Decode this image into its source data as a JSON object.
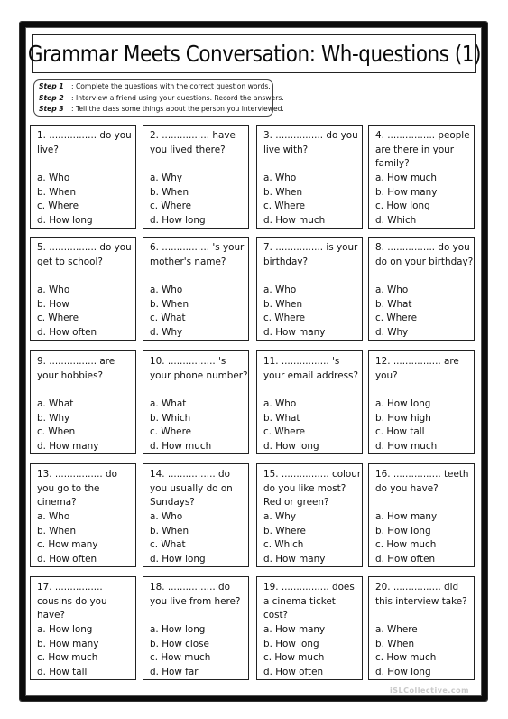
{
  "title": "Grammar Meets Conversation: Wh-questions (1)",
  "steps": [
    {
      "label": "Step 1",
      "text": ": Complete the questions with the correct question words."
    },
    {
      "label": "Step 2",
      "text": ": Interview a friend using your questions. Record the answers."
    },
    {
      "label": "Step 3",
      "text": ": Tell the class some things about the person you interviewed."
    }
  ],
  "questions": [
    {
      "text": "1. ................ do you live?",
      "options": [
        "a. Who",
        "b. When",
        "c. Where",
        "d. How long"
      ]
    },
    {
      "text": "2. ................ have you lived there?",
      "options": [
        "a. Why",
        "b. When",
        "c. Where",
        "d. How long"
      ]
    },
    {
      "text": "3. ................ do you live with?",
      "options": [
        "a. Who",
        "b. When",
        "c. Where",
        "d. How much"
      ]
    },
    {
      "text": "4. ................ people are there in your family?",
      "options": [
        "a. How much",
        "b. How many",
        "c. How long",
        "d. Which"
      ]
    },
    {
      "text": "5. ................ do you get to school?",
      "options": [
        "a. Who",
        "b. How",
        "c. Where",
        "d. How often"
      ]
    },
    {
      "text": "6. ................ 's your mother's name?",
      "options": [
        "a. Who",
        "b. When",
        "c. What",
        "d. Why"
      ]
    },
    {
      "text": "7. ................ is your birthday?",
      "options": [
        "a. Who",
        "b. When",
        "c. Where",
        "d. How many"
      ]
    },
    {
      "text": "8. ................ do you do on your birthday?",
      "options": [
        "a. Who",
        "b. What",
        "c. Where",
        "d. Why"
      ]
    },
    {
      "text": "9. ................ are your hobbies?",
      "options": [
        "a. What",
        "b. Why",
        "c. When",
        "d. How many"
      ]
    },
    {
      "text": "10. ................ 's your phone number?",
      "options": [
        "a. What",
        "b. Which",
        "c. Where",
        "d. How much"
      ]
    },
    {
      "text": "11. ................ 's your email address?",
      "options": [
        "a. Who",
        "b. What",
        "c. Where",
        "d. How long"
      ]
    },
    {
      "text": "12. ................ are you?",
      "options": [
        "a. How long",
        "b. How high",
        "c. How tall",
        "d. How much"
      ]
    },
    {
      "text": "13. ................ do you go to the cinema?",
      "options": [
        "a. Who",
        "b. When",
        "c. How many",
        "d. How often"
      ]
    },
    {
      "text": "14. ................ do you usually do on Sundays?",
      "options": [
        "a. Who",
        "b. When",
        "c. What",
        "d. How long"
      ]
    },
    {
      "text": "15. ................ colour do you like most? Red or green?",
      "options": [
        "a. Why",
        "b. Where",
        "c. Which",
        "d. How many"
      ]
    },
    {
      "text": "16. ................ teeth do you have?",
      "options": [
        "a. How many",
        "b. How long",
        "c. How much",
        "d. How often"
      ]
    },
    {
      "text": "17. ................ cousins do you have?",
      "options": [
        "a. How long",
        "b. How many",
        "c. How much",
        "d. How tall"
      ]
    },
    {
      "text": "18. ................ do you live from here?",
      "options": [
        "a. How long",
        "b. How close",
        "c. How much",
        "d. How far"
      ]
    },
    {
      "text": "19. ................ does a cinema ticket cost?",
      "options": [
        "a. How many",
        "b. How long",
        "c. How much",
        "d. How often"
      ]
    },
    {
      "text": "20. ................ did this interview take?",
      "options": [
        "a. Where",
        "b. When",
        "c. How much",
        "d. How long"
      ]
    }
  ],
  "watermark": "iSLCollective.com"
}
